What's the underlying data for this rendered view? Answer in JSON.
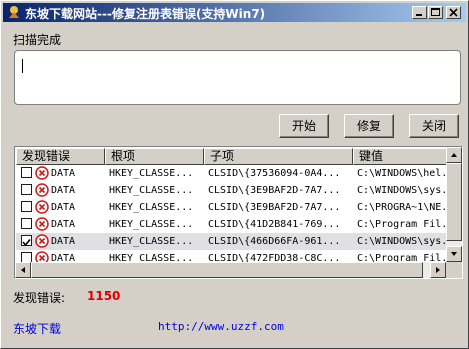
{
  "window": {
    "title": "东坡下载网站---修复注册表错误(支持Win7)"
  },
  "status_label": "扫描完成",
  "textbox": {
    "value": ""
  },
  "buttons": {
    "start": "开始",
    "repair": "修复",
    "close": "关闭"
  },
  "columns": [
    "发现错误",
    "根项",
    "子项",
    "键值"
  ],
  "rows": [
    {
      "checked": false,
      "type": "DATA",
      "root": "HKEY_CLASSE...",
      "sub": "CLSID\\{37536094-0A4...",
      "value": "C:\\WINDOWS\\hel..."
    },
    {
      "checked": false,
      "type": "DATA",
      "root": "HKEY_CLASSE...",
      "sub": "CLSID\\{3E9BAF2D-7A7...",
      "value": "C:\\WINDOWS\\sys..."
    },
    {
      "checked": false,
      "type": "DATA",
      "root": "HKEY_CLASSE...",
      "sub": "CLSID\\{3E9BAF2D-7A7...",
      "value": "C:\\PROGRA~1\\NE..."
    },
    {
      "checked": false,
      "type": "DATA",
      "root": "HKEY_CLASSE...",
      "sub": "CLSID\\{41D2B841-769...",
      "value": "C:\\Program Fil..."
    },
    {
      "checked": true,
      "type": "DATA",
      "root": "HKEY_CLASSE...",
      "sub": "CLSID\\{466D66FA-961...",
      "value": "C:\\WINDOWS\\sys...",
      "selected": true
    },
    {
      "checked": false,
      "type": "DATA",
      "root": "HKEY_CLASSE...",
      "sub": "CLSID\\{472FDD38-C8C...",
      "value": "C:\\Program Fil..."
    }
  ],
  "error_count": {
    "label": "发现错误:",
    "value": "1150"
  },
  "footer": {
    "site_name": "东坡下载",
    "url": "http://www.uzzf.com"
  },
  "colors": {
    "title_start": "#0a246a",
    "title_end": "#a6caf0",
    "count": "#e00000",
    "link": "#0000e0"
  }
}
